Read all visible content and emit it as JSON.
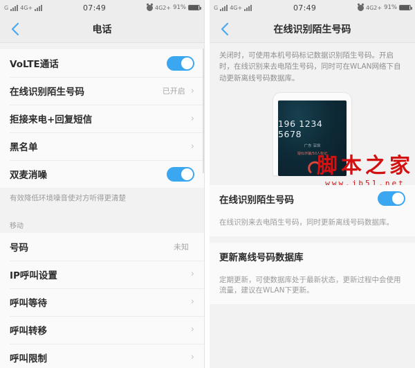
{
  "status_bar": {
    "carrier_g": "G",
    "network": "4G+",
    "time": "07:49",
    "network_right": "4G2+",
    "battery_pct": "91%",
    "alarm_icon": "alarm-clock-icon",
    "signal_icon": "signal-bars-icon",
    "battery_icon": "battery-icon"
  },
  "left_screen": {
    "nav": {
      "back_icon": "back-chevron-icon",
      "title": "电话"
    },
    "rows_group1": [
      {
        "label": "VoLTE通话",
        "control": "toggle",
        "on": true
      },
      {
        "label": "在线识别陌生号码",
        "value": "已开启",
        "control": "chevron"
      },
      {
        "label": "拒接来电+回复短信",
        "control": "chevron"
      },
      {
        "label": "黑名单",
        "control": "chevron"
      },
      {
        "label": "双麦消噪",
        "control": "toggle",
        "on": true
      }
    ],
    "hint1": "有效降低环境噪音使对方听得更清楚",
    "group2_title": "移动",
    "rows_group2": [
      {
        "label": "号码",
        "value": "未知",
        "control": "none"
      },
      {
        "label": "IP呼叫设置",
        "control": "chevron"
      },
      {
        "label": "呼叫等待",
        "control": "chevron"
      },
      {
        "label": "呼叫转移",
        "control": "chevron"
      },
      {
        "label": "呼叫限制",
        "control": "chevron"
      }
    ]
  },
  "right_screen": {
    "nav": {
      "back_icon": "back-chevron-icon",
      "title": "在线识别陌生号码"
    },
    "description": "关闭时，可使用本机号码标记数据识别陌生号码。开启时，在线识别来去电陌生号码，同时可在WLAN网络下自动更新离线号码数据库。",
    "illustration": {
      "phone_number": "196 1234 5678",
      "location": "广东 深圳",
      "mark_tag": "疑似诈骗/50人标记",
      "hangup_icon": "hangup-phone-icon"
    },
    "toggle_row": {
      "label": "在线识别陌生号码",
      "control": "toggle",
      "on": true
    },
    "toggle_hint": "在线识别来去电陌生号码，同时更新离线号码数据库。",
    "update_row": {
      "label": "更新离线号码数据库"
    },
    "update_hint": "定期更新，可使数据库处于最新状态，更新过程中会使用流量，建议在WLAN下更新。"
  },
  "watermark": {
    "main": "脚本之家",
    "sub": "www.jb51.net"
  },
  "colors": {
    "accent": "#3ba7f0",
    "back_arrow": "#4aa8ef",
    "watermark_red": "#d41111"
  }
}
